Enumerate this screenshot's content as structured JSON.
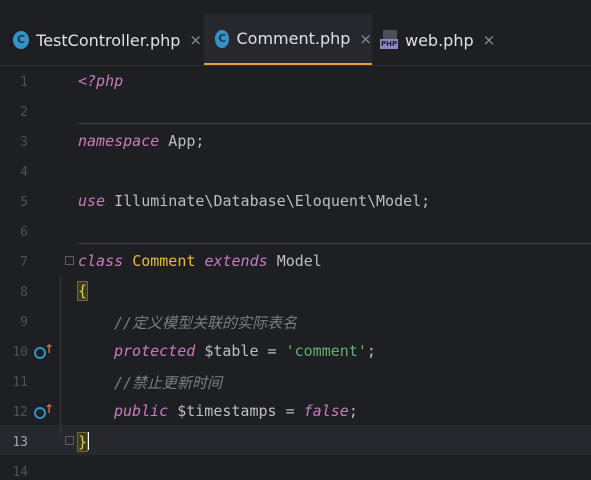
{
  "tabs": [
    {
      "label": "TestController.php",
      "icon": "class-icon",
      "icon_letter": "C",
      "active": false
    },
    {
      "label": "Comment.php",
      "icon": "class-icon",
      "icon_letter": "C",
      "active": true
    },
    {
      "label": "web.php",
      "icon": "php-file-icon",
      "icon_letter": "PHP",
      "active": false
    }
  ],
  "close_glyph": "×",
  "editor": {
    "line_numbers": [
      "1",
      "2",
      "3",
      "4",
      "5",
      "6",
      "7",
      "8",
      "9",
      "10",
      "11",
      "12",
      "13",
      "14"
    ],
    "current_line": 13,
    "lines": {
      "l1": {
        "open_tag": "<?php"
      },
      "l3": {
        "keyword": "namespace",
        "rest": " App;"
      },
      "l5": {
        "keyword": "use",
        "rest": " Illuminate\\Database\\Eloquent\\Model;"
      },
      "l7": {
        "keyword_class": "class",
        "class_name": "Comment",
        "keyword_extends": "extends",
        "parent": "Model"
      },
      "l8": {
        "brace": "{"
      },
      "l9": {
        "comment": "//定义模型关联的实际表名"
      },
      "l10": {
        "keyword": "protected",
        "variable": "$table",
        "op": " = ",
        "string": "'comment'",
        "end": ";"
      },
      "l11": {
        "comment": "//禁止更新时间"
      },
      "l12": {
        "keyword": "public",
        "variable": "$timestamps",
        "op": " = ",
        "value": "false",
        "end": ";"
      },
      "l13": {
        "brace": "}"
      }
    },
    "gutter_markers": [
      "override-icon",
      "override-icon"
    ]
  },
  "colors": {
    "background": "#1e1f22",
    "current_line": "#26282e",
    "keyword": "#c77dbb",
    "class_name": "#e8ba36",
    "string": "#6aab73",
    "comment": "#7a7e85",
    "active_tab_underline": "#f0a030",
    "class_icon": "#3592c4"
  }
}
